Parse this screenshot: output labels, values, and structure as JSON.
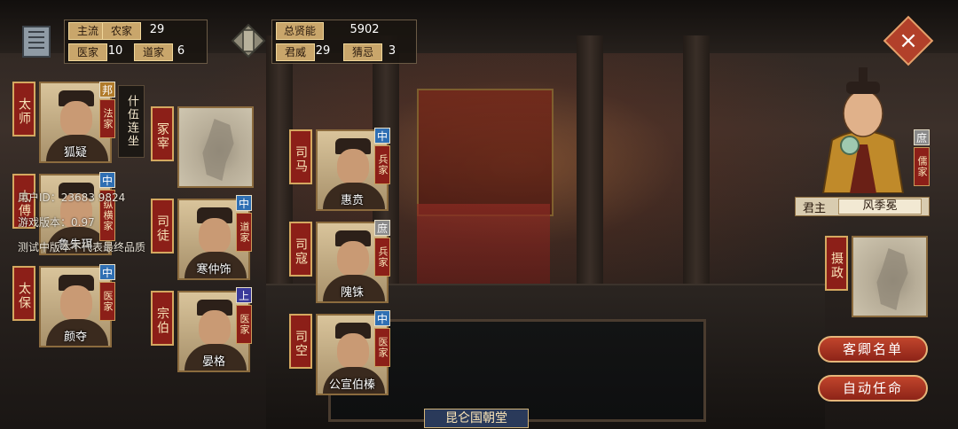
{
  "hud_left": {
    "row1": {
      "label": "主流",
      "school": "农家",
      "value": "29"
    },
    "row2": {
      "school1": "医家",
      "value1": "10",
      "school2": "道家",
      "value2": "6"
    }
  },
  "hud_mid": {
    "row1": {
      "label": "总贤能",
      "value": "5902"
    },
    "row2": {
      "label1": "君威",
      "value1": "29",
      "label2": "猜忌",
      "value2": "3"
    }
  },
  "close_label": "×",
  "slots": [
    {
      "title": "太师",
      "name": "狐疑",
      "rank": "邦",
      "school": "法家"
    },
    {
      "title": "太傅",
      "name": "鲁朱珥",
      "rank": "中",
      "school": "纵横家"
    },
    {
      "title": "太保",
      "name": "颜夺",
      "rank": "中",
      "school": "医家"
    },
    {
      "title": "冢宰",
      "name": "",
      "rank": "",
      "school": ""
    },
    {
      "title": "司徒",
      "name": "寒仲饰",
      "rank": "中",
      "school": "道家"
    },
    {
      "title": "宗伯",
      "name": "晏格",
      "rank": "上",
      "school": "医家"
    },
    {
      "title": "司马",
      "name": "惠贲",
      "rank": "中",
      "school": "兵家"
    },
    {
      "title": "司寇",
      "name": "隗铢",
      "rank": "庶",
      "school": "兵家"
    },
    {
      "title": "司空",
      "name": "公宣伯榛",
      "rank": "中",
      "school": "医家"
    }
  ],
  "bonus_tag": "什伍连坐",
  "debug": {
    "uid": "用户ID：23683 9824",
    "version": "游戏版本：0.97",
    "notice": "测试中版本不代表最终品质"
  },
  "ruler": {
    "rank": "庶",
    "school": "儒家",
    "label": "君主",
    "name": "风季冕"
  },
  "regent": {
    "title": "摄政"
  },
  "buttons": {
    "guests": "客卿名单",
    "auto": "自动任命"
  },
  "banner": "昆仑国朝堂",
  "colors": {
    "accent": "#8c1f18",
    "gold": "#d4a860",
    "rank_mid": "#2f6fb3",
    "rank_up": "#3a3a9a",
    "rank_low": "#8a8a8a",
    "rank_bang": "#b07a2a"
  }
}
